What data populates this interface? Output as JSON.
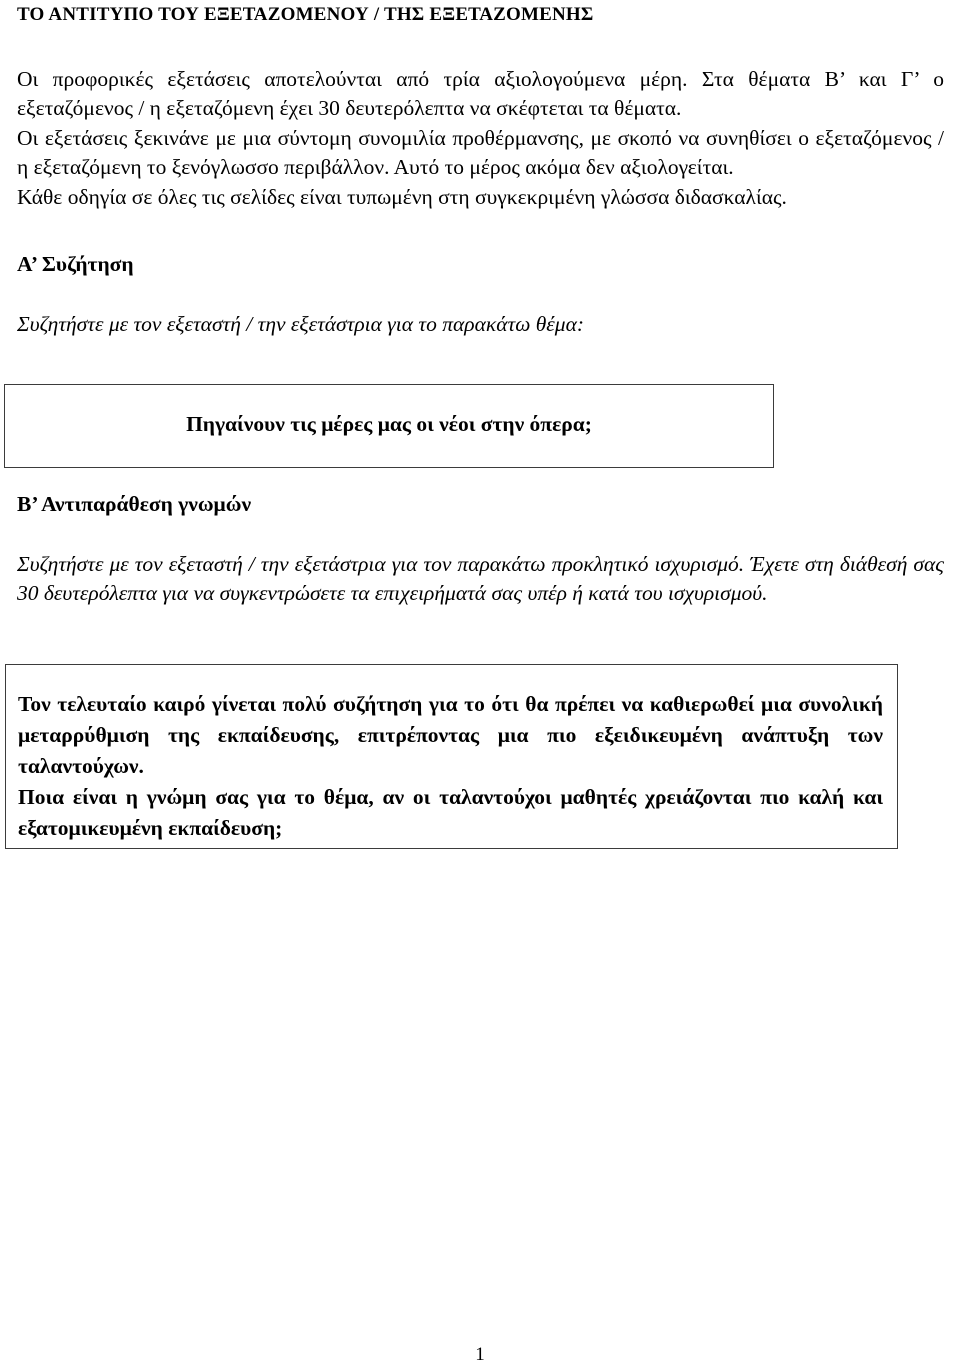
{
  "document": {
    "title": "ΤΟ ΑΝΤΙΤΥΠΟ ΤΟΥ ΕΞΕΤΑΖΟΜΕΝΟΥ / ΤΗΣ ΕΞΕΤΑΖΟΜΕΝΗΣ",
    "page_number": "1"
  },
  "intro": {
    "paragraph_1": "Οι προφορικές εξετάσεις αποτελούνται από τρία αξιολογούμενα μέρη. Στα θέματα Β’ και Γ’ ο εξεταζόμενος / η εξεταζόμενη έχει 30 δευτερόλεπτα να σκέφτεται τα θέματα.",
    "paragraph_2": "Οι εξετάσεις ξεκινάνε με μια σύντομη συνομιλία προθέρμανσης, με σκοπό να συνηθίσει ο εξεταζόμενος / η εξεταζόμενη το ξενόγλωσσο περιβάλλον. Αυτό το μέρος ακόμα δεν αξιολογείται.",
    "paragraph_3": "Κάθε οδηγία σε όλες τις σελίδες είναι τυπωμένη στη συγκεκριμένη γλώσσα διδασκαλίας."
  },
  "section_a": {
    "heading": "Α’ Συζήτηση",
    "instruction": "Συζητήστε με τον εξεταστή / την εξετάστρια για το παρακάτω θέμα:",
    "topic": "Πηγαίνουν τις μέρες μας οι νέοι στην όπερα;"
  },
  "section_b": {
    "heading": "Β’ Αντιπαράθεση γνωμών",
    "instruction": "Συζητήστε με τον εξεταστή / την εξετάστρια για τον παρακάτω προκλητικό ισχυρισμό. Έχετε στη διάθεσή σας 30 δευτερόλεπτα για να συγκεντρώσετε τα επιχειρήματά σας υπέρ ή κατά του ισχυρισμού.",
    "statement_paragraph_1": "Τον τελευταίο καιρό γίνεται πολύ συζήτηση για το ότι θα πρέπει να καθιερωθεί μια συνολική μεταρρύθμιση της εκπαίδευσης, επιτρέποντας μια πιο εξειδικευμένη ανάπτυξη των ταλαντούχων.",
    "statement_paragraph_2": "Ποια είναι η γνώμη σας για το θέμα, αν οι ταλαντούχοι μαθητές χρειάζονται πιο καλή και εξατομικευμένη εκπαίδευση;"
  }
}
